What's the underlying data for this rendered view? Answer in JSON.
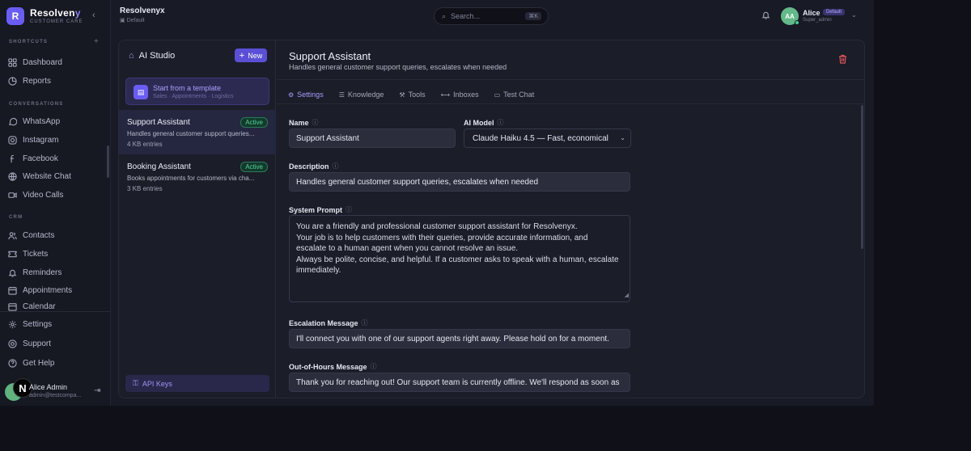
{
  "brand": {
    "logo_letter": "R",
    "name_main": "Resolven",
    "name_faded": "y",
    "subtitle": "CUSTOMER CARE",
    "collapse_icon": "chevron-left"
  },
  "workspace": {
    "name": "Resolvenyx",
    "sub": "Default"
  },
  "search": {
    "placeholder": "Search...",
    "shortcut": "⌘K"
  },
  "user": {
    "initials": "AA",
    "name": "Alice",
    "badge": "Default",
    "role": "Super_admin"
  },
  "sidebar": {
    "sections": {
      "shortcuts": "SHORTCUTS",
      "conversations": "CONVERSATIONS",
      "crm": "CRM"
    },
    "shortcuts": [
      {
        "label": "Dashboard",
        "icon": "grid-icon"
      },
      {
        "label": "Reports",
        "icon": "chart-icon"
      }
    ],
    "conversations": [
      {
        "label": "WhatsApp",
        "icon": "chat-icon"
      },
      {
        "label": "Instagram",
        "icon": "instagram-icon"
      },
      {
        "label": "Facebook",
        "icon": "facebook-icon"
      },
      {
        "label": "Website Chat",
        "icon": "globe-icon"
      },
      {
        "label": "Video Calls",
        "icon": "video-icon"
      }
    ],
    "crm": [
      {
        "label": "Contacts",
        "icon": "users-icon"
      },
      {
        "label": "Tickets",
        "icon": "ticket-icon"
      },
      {
        "label": "Reminders",
        "icon": "bell-icon"
      },
      {
        "label": "Appointments",
        "icon": "calendar-check-icon"
      },
      {
        "label": "Calendar",
        "icon": "calendar-icon"
      }
    ],
    "bottom": [
      {
        "label": "Settings",
        "icon": "gear-icon"
      },
      {
        "label": "Support",
        "icon": "help-icon"
      },
      {
        "label": "Get Help",
        "icon": "question-icon"
      }
    ],
    "footer": {
      "name": "Alice Admin",
      "email": "admin@testcompa...",
      "n_badge": "N"
    }
  },
  "studio": {
    "title": "AI Studio",
    "new_label": "New",
    "template": {
      "title": "Start from a template",
      "sub": "Sales · Appointments · Logistics"
    },
    "agents": [
      {
        "name": "Support Assistant",
        "badge": "Active",
        "desc": "Handles general customer support queries...",
        "meta": "4 KB entries"
      },
      {
        "name": "Booking Assistant",
        "badge": "Active",
        "desc": "Books appointments for customers via cha...",
        "meta": "3 KB entries"
      }
    ],
    "api_keys": "API Keys"
  },
  "editor": {
    "title": "Support Assistant",
    "subtitle": "Handles general customer support queries, escalates when needed",
    "tabs": [
      "Settings",
      "Knowledge",
      "Tools",
      "Inboxes",
      "Test Chat"
    ],
    "fields": {
      "name_label": "Name",
      "name_value": "Support Assistant",
      "model_label": "AI Model",
      "model_value": "Claude Haiku 4.5 — Fast, economical",
      "desc_label": "Description",
      "desc_value": "Handles general customer support queries, escalates when needed",
      "prompt_label": "System Prompt",
      "prompt_lines": [
        "You are a friendly and professional customer support assistant for Resolvenyx.",
        "Your job is to help customers with their queries, provide accurate information, and",
        "escalate to a human agent when you cannot resolve an issue.",
        "Always be polite, concise, and helpful. If a customer asks to speak with a human, escalate",
        "immediately."
      ],
      "escalation_label": "Escalation Message",
      "escalation_value": "I'll connect you with one of our support agents right away. Please hold on for a moment.",
      "ooh_label": "Out-of-Hours Message",
      "ooh_value": "Thank you for reaching out! Our support team is currently offline. We'll respond as soon as"
    }
  },
  "colors": {
    "accent": "#6a5cf6",
    "active_green": "#52d39a",
    "danger": "#e0555b"
  }
}
